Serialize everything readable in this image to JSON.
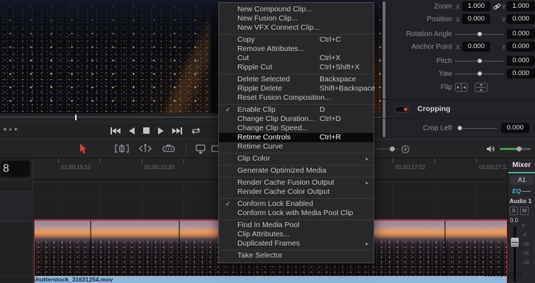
{
  "menu": {
    "sections": [
      {
        "items": [
          {
            "label": "New Compound Clip..."
          },
          {
            "label": "New Fusion Clip..."
          },
          {
            "label": "New VFX Connect Clip..."
          }
        ]
      },
      {
        "items": [
          {
            "label": "Copy",
            "shortcut": "Ctrl+C"
          },
          {
            "label": "Remove Attributes..."
          },
          {
            "label": "Cut",
            "shortcut": "Ctrl+X"
          },
          {
            "label": "Ripple Cut",
            "shortcut": "Ctrl+Shift+X"
          }
        ]
      },
      {
        "items": [
          {
            "label": "Delete Selected",
            "shortcut": "Backspace"
          },
          {
            "label": "Ripple Delete",
            "shortcut": "Shift+Backspace"
          },
          {
            "label": "Reset Fusion Composition..."
          }
        ]
      },
      {
        "items": [
          {
            "label": "Enable Clip",
            "shortcut": "D",
            "checked": true
          },
          {
            "label": "Change Clip Duration...",
            "shortcut": "Ctrl+D"
          },
          {
            "label": "Change Clip Speed..."
          },
          {
            "label": "Retime Controls",
            "shortcut": "Ctrl+R",
            "highlighted": true
          },
          {
            "label": "Retime Curve"
          }
        ]
      },
      {
        "items": [
          {
            "label": "Clip Color",
            "submenu": true
          }
        ]
      },
      {
        "items": [
          {
            "label": "Generate Optimized Media"
          }
        ]
      },
      {
        "items": [
          {
            "label": "Render Cache Fusion Output",
            "submenu": true
          },
          {
            "label": "Render Cache Color Output"
          }
        ]
      },
      {
        "items": [
          {
            "label": "Conform Lock Enabled",
            "checked": true
          },
          {
            "label": "Conform Lock with Media Pool Clip"
          }
        ]
      },
      {
        "items": [
          {
            "label": "Find In Media Pool"
          },
          {
            "label": "Clip Attributes..."
          },
          {
            "label": "Duplicated Frames",
            "submenu": true
          }
        ]
      },
      {
        "items": [
          {
            "label": "Take Selector"
          }
        ]
      }
    ]
  },
  "inspector": {
    "zoom": {
      "label": "Zoom",
      "x_label": "X",
      "y_label": "Y",
      "x": "1.000",
      "y": "1.000"
    },
    "position": {
      "label": "Position",
      "x_label": "X",
      "y_label": "Y",
      "x": "0.000",
      "y": "0.000"
    },
    "rotation": {
      "label": "Rotation Angle",
      "value": "0.000"
    },
    "anchor": {
      "label": "Anchor Point",
      "x_label": "X",
      "y_label": "Y",
      "x": "0.000",
      "y": "0.000"
    },
    "pitch": {
      "label": "Pitch",
      "value": "0.000"
    },
    "yaw": {
      "label": "Yaw",
      "value": "0.000"
    },
    "flip": {
      "label": "Flip"
    },
    "cropping": {
      "label": "Cropping"
    },
    "crop_left": {
      "label": "Crop Left",
      "value": "0.000"
    }
  },
  "timeline": {
    "timecode_fragment": "8",
    "ruler_labels": [
      "01:00:15:10",
      "01:00:15:20",
      "01:00:17:02",
      "01:00:17:12"
    ],
    "clip_name": "shutterstock_31631254.mov"
  },
  "mixer": {
    "title": "Mixer",
    "channel": "A1",
    "eq_label": "EQ",
    "track_label": "Audio 1",
    "solo": "S",
    "mute": "M",
    "gain": "0.0",
    "scale": [
      "0",
      "-5",
      "-10",
      "-15",
      "-20"
    ]
  },
  "watermark": "wtvid.com",
  "icons": {
    "jog-back": "◂",
    "jog-dot": "●",
    "jog-forward": "▸",
    "skip-back": "|◀◀",
    "step-back": "◀",
    "stop": "■",
    "play": "▶",
    "skip-forward": "▶▶|",
    "loop": "circular-arrows",
    "cursor": "red-arrow",
    "trim-edit": "brackets",
    "dynamic-trim": "angle-playhead",
    "razor": "blade",
    "insert-clip": "monitor-down-arrow",
    "overwrite-clip": "monitor-corner-arrow",
    "replace-clip": "stacked-rects",
    "zoom-fit": "circle-plus",
    "volume": "speaker",
    "link": "chain",
    "check": "✓",
    "submenu": "▸"
  },
  "colors": {
    "selection_red": "#b5342a",
    "cursor_red": "#cf4436",
    "clip_bar_blue": "#8fb7da",
    "mixer_accent_green": "#3dbd8d",
    "volume_green": "#4a9a44",
    "eq_teal": "#3fc1c9",
    "toggle_red": "#e0443c",
    "menu_bg": "#28282b",
    "menu_highlight": "#0a0a0c"
  }
}
